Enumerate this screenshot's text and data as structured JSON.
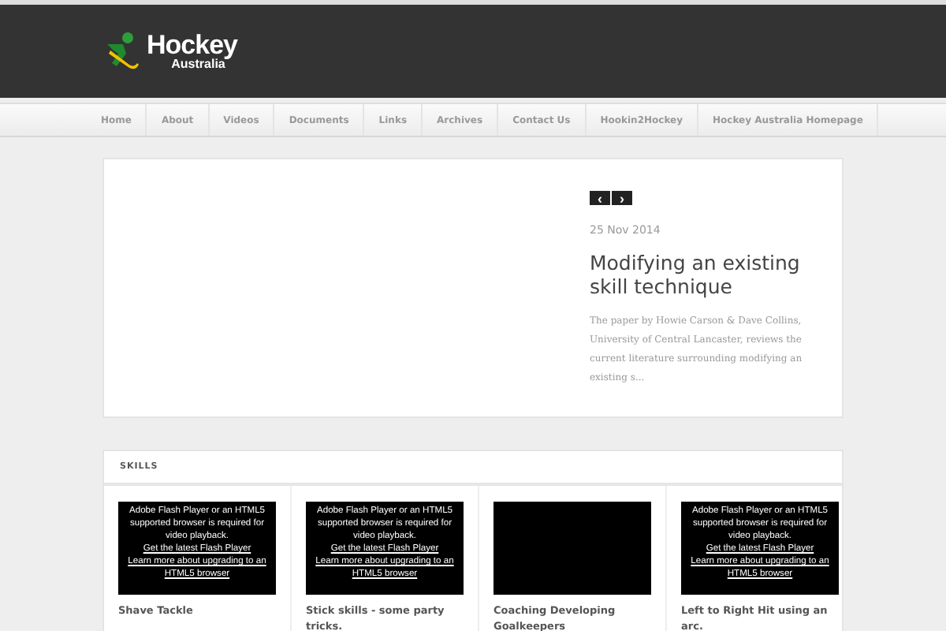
{
  "logo": {
    "title": "Hockey",
    "subtitle": "Australia"
  },
  "nav": [
    {
      "label": "Home"
    },
    {
      "label": "About"
    },
    {
      "label": "Videos"
    },
    {
      "label": "Documents"
    },
    {
      "label": "Links"
    },
    {
      "label": "Archives"
    },
    {
      "label": "Contact Us"
    },
    {
      "label": "Hookin2Hockey"
    },
    {
      "label": "Hockey Australia Homepage"
    }
  ],
  "slider": {
    "prev": "‹",
    "next": "›",
    "date": "25 Nov 2014",
    "title": "Modifying an existing skill technique",
    "excerpt": "The paper by Howie Carson & Dave Collins, University of Central Lancaster, reviews the current literature surrounding modifying an existing s..."
  },
  "skills": {
    "heading": "SKILLS",
    "videos": [
      {
        "kind": "flash",
        "message": "Adobe Flash Player or an HTML5 supported browser is required for video playback.",
        "link1": "Get the latest Flash Player",
        "link2": "Learn more about upgrading to an HTML5 browser",
        "title": "Shave Tackle"
      },
      {
        "kind": "flash",
        "message": "Adobe Flash Player or an HTML5 supported browser is required for video playback.",
        "link1": "Get the latest Flash Player",
        "link2": "Learn more about upgrading to an HTML5 browser",
        "title": "Stick skills - some party tricks."
      },
      {
        "kind": "blank",
        "title": "Coaching Developing Goalkeepers"
      },
      {
        "kind": "flash",
        "message": "Adobe Flash Player or an HTML5 supported browser is required for video playback.",
        "link1": "Get the latest Flash Player",
        "link2": "Learn more about upgrading to an HTML5 browser",
        "title": "Left to Right Hit using an arc."
      }
    ]
  }
}
